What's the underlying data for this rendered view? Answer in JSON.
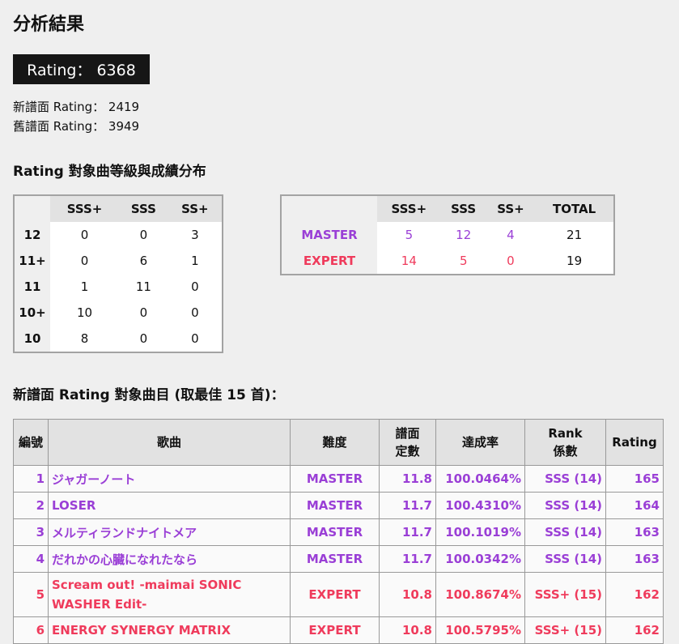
{
  "page": {
    "title": "分析結果",
    "rating_label": "Rating： 6368",
    "new_rating": "新譜面 Rating： 2419",
    "old_rating": "舊譜面 Rating： 3949",
    "dist_title": "Rating 對象曲等級與成績分布",
    "songs_title": "新譜面 Rating 對象曲目 (取最佳 15 首)："
  },
  "colors": {
    "master": "#9a3fd6",
    "expert": "#ef3b5c"
  },
  "level_table": {
    "headers": [
      "SSS+",
      "SSS",
      "SS+"
    ],
    "rows": [
      {
        "level": "12",
        "values": [
          "0",
          "0",
          "3"
        ]
      },
      {
        "level": "11+",
        "values": [
          "0",
          "6",
          "1"
        ]
      },
      {
        "level": "11",
        "values": [
          "1",
          "11",
          "0"
        ]
      },
      {
        "level": "10+",
        "values": [
          "10",
          "0",
          "0"
        ]
      },
      {
        "level": "10",
        "values": [
          "8",
          "0",
          "0"
        ]
      }
    ]
  },
  "difficulty_table": {
    "headers": [
      "SSS+",
      "SSS",
      "SS+",
      "TOTAL"
    ],
    "rows": [
      {
        "difficulty": "MASTER",
        "values": [
          "5",
          "12",
          "4"
        ],
        "total": "21"
      },
      {
        "difficulty": "EXPERT",
        "values": [
          "14",
          "5",
          "0"
        ],
        "total": "19"
      }
    ]
  },
  "songs_table": {
    "headers": {
      "no": "編號",
      "song": "歌曲",
      "difficulty": "難度",
      "constant_1": "譜面",
      "constant_2": "定數",
      "achievement": "達成率",
      "rank_1": "Rank",
      "rank_2": "係數",
      "rating": "Rating"
    },
    "rows": [
      {
        "no": "1",
        "title": "ジャガーノート",
        "title2": "",
        "difficulty": "MASTER",
        "constant": "11.8",
        "achievement": "100.0464%",
        "rank": "SSS (14)",
        "rating": "165"
      },
      {
        "no": "2",
        "title": "LOSER",
        "title2": "",
        "difficulty": "MASTER",
        "constant": "11.7",
        "achievement": "100.4310%",
        "rank": "SSS (14)",
        "rating": "164"
      },
      {
        "no": "3",
        "title": "メルティランドナイトメア",
        "title2": "",
        "difficulty": "MASTER",
        "constant": "11.7",
        "achievement": "100.1019%",
        "rank": "SSS (14)",
        "rating": "163"
      },
      {
        "no": "4",
        "title": "だれかの心臓になれたなら",
        "title2": "",
        "difficulty": "MASTER",
        "constant": "11.7",
        "achievement": "100.0342%",
        "rank": "SSS (14)",
        "rating": "163"
      },
      {
        "no": "5",
        "title": "Scream out! -maimai SONIC",
        "title2": "WASHER Edit-",
        "difficulty": "EXPERT",
        "constant": "10.8",
        "achievement": "100.8674%",
        "rank": "SSS+ (15)",
        "rating": "162"
      },
      {
        "no": "6",
        "title": "ENERGY SYNERGY MATRIX",
        "title2": "",
        "difficulty": "EXPERT",
        "constant": "10.8",
        "achievement": "100.5795%",
        "rank": "SSS+ (15)",
        "rating": "162"
      }
    ]
  }
}
